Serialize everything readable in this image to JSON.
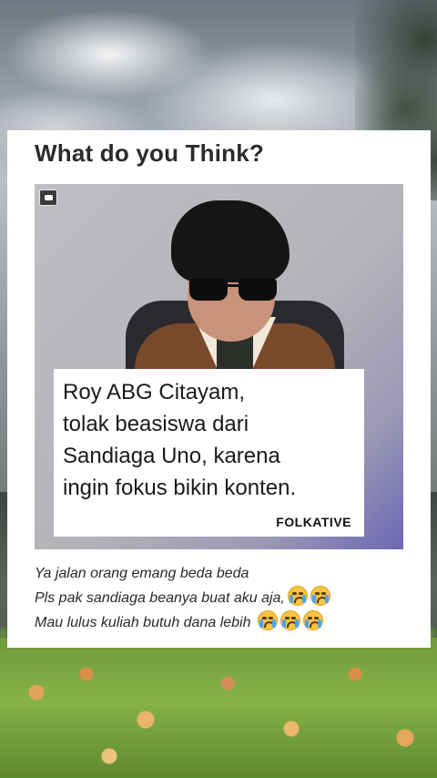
{
  "post": {
    "title": "What do you Think?",
    "quote": "Roy ABG Citayam,\ntolak beasiswa dari\nSandiaga Uno, karena\ningin fokus bikin konten.",
    "brand": "FOLKATIVE",
    "caption_lines": [
      "Ya jalan orang emang beda beda",
      "Pls pak sandiaga beanya buat aku aja,",
      "Mau lulus kuliah butuh dana lebih"
    ],
    "emoji_name": "loudly-crying-face-icon"
  }
}
